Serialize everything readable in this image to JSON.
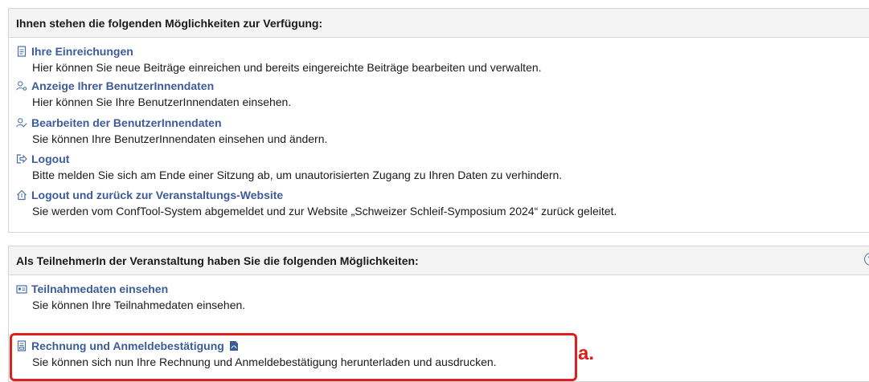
{
  "panel1": {
    "header": "Ihnen stehen die folgenden Möglichkeiten zur Verfügung:",
    "items": [
      {
        "icon": "document-icon",
        "label": "Ihre Einreichungen",
        "desc": "Hier können Sie neue Beiträge einreichen und bereits eingereichte Beiträge bearbeiten und verwalten."
      },
      {
        "icon": "user-view-icon",
        "label": "Anzeige Ihrer BenutzerInnendaten",
        "desc": "Hier können Sie Ihre BenutzerInnendaten einsehen."
      },
      {
        "icon": "user-edit-icon",
        "label": "Bearbeiten der BenutzerInnendaten",
        "desc": "Sie können Ihre BenutzerInnendaten einsehen und ändern."
      },
      {
        "icon": "logout-icon",
        "label": "Logout",
        "desc": "Bitte melden Sie sich am Ende einer Sitzung ab, um unautorisierten Zugang zu Ihren Daten zu verhindern."
      },
      {
        "icon": "home-logout-icon",
        "label": "Logout und zurück zur Veranstaltungs-Website",
        "desc": "Sie werden vom ConfTool-System abgemeldet und zur Website „Schweizer Schleif-Symposium 2024“ zurück geleitet."
      }
    ]
  },
  "panel2": {
    "header": "Als TeilnehmerIn der Veranstaltung haben Sie die folgenden Möglichkeiten:",
    "help": "?",
    "items": [
      {
        "icon": "id-card-icon",
        "label": "Teilnahmedaten einsehen",
        "desc": "Sie können Ihre Teilnahmedaten einsehen."
      },
      {
        "icon": "invoice-icon",
        "label": "Rechnung und Anmeldebestätigung",
        "desc": "Sie können sich nun Ihre Rechnung und Anmeldebestätigung herunterladen und ausdrucken."
      }
    ]
  },
  "annotation": {
    "label": "a.",
    "color": "#e01e1e"
  }
}
